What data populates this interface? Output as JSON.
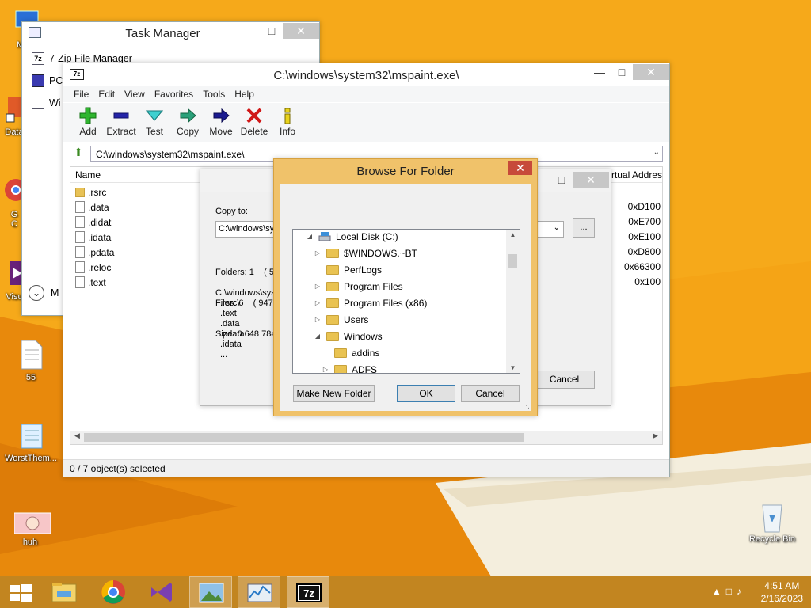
{
  "desktop": {
    "icons": [
      {
        "label": "My C",
        "icon": "computer-icon"
      },
      {
        "label": "Data",
        "icon": "shortcut-icon"
      },
      {
        "label": "G\nC",
        "icon": "chrome-icon"
      },
      {
        "label": "Visu",
        "icon": "visual-studio-icon"
      },
      {
        "label": "55",
        "icon": "text-file-icon"
      },
      {
        "label": "WorstThem...",
        "icon": "notepad-icon"
      },
      {
        "label": "huh",
        "icon": "image-icon"
      },
      {
        "label": "Recycle Bin",
        "icon": "recycle-bin-icon"
      }
    ]
  },
  "task_manager": {
    "title": "Task Manager",
    "items": [
      {
        "label": "7-Zip File Manager",
        "icon": "7z-icon"
      },
      {
        "label": "PC",
        "icon": "app-icon"
      },
      {
        "label": "Wi",
        "icon": "window-icon"
      }
    ],
    "footer": "M"
  },
  "zip": {
    "title": "C:\\windows\\system32\\mspaint.exe\\",
    "menu": [
      "File",
      "Edit",
      "View",
      "Favorites",
      "Tools",
      "Help"
    ],
    "toolbar": [
      {
        "label": "Add",
        "icon": "add-icon"
      },
      {
        "label": "Extract",
        "icon": "extract-icon"
      },
      {
        "label": "Test",
        "icon": "test-icon"
      },
      {
        "label": "Copy",
        "icon": "copy-icon"
      },
      {
        "label": "Move",
        "icon": "move-icon"
      },
      {
        "label": "Delete",
        "icon": "delete-icon"
      },
      {
        "label": "Info",
        "icon": "info-icon"
      }
    ],
    "address": "C:\\windows\\system32\\mspaint.exe\\",
    "columns": {
      "name": "Name",
      "vaddr": "rtual Addres"
    },
    "files": [
      {
        "name": ".rsrc",
        "folder": true,
        "vaddr": "0xD100"
      },
      {
        "name": ".data",
        "folder": false,
        "vaddr": "0xE700"
      },
      {
        "name": ".didat",
        "folder": false,
        "vaddr": "0xE100"
      },
      {
        "name": ".idata",
        "folder": false,
        "vaddr": "0xD800"
      },
      {
        "name": ".pdata",
        "folder": false,
        "vaddr": "0x66300"
      },
      {
        "name": ".reloc",
        "folder": false,
        "vaddr": "0x100"
      },
      {
        "name": ".text",
        "folder": false,
        "vaddr": ""
      }
    ],
    "status": "0 / 7 object(s) selected"
  },
  "copy_dialog": {
    "copy_to_label": "Copy to:",
    "path": "C:\\windows\\sy",
    "browse": "...",
    "info": [
      "Folders: 1    ( 5",
      "Files: 6    ( 947",
      "Size: 6 648 784"
    ],
    "list": [
      "C:\\windows\\sys",
      ".rsrc\\",
      ".text",
      ".data",
      ".pdata",
      ".idata",
      "..."
    ],
    "cancel": "Cancel"
  },
  "browse": {
    "title": "Browse For Folder",
    "tree": [
      {
        "label": "Local Disk (C:)",
        "level": 0,
        "expand": "open",
        "type": "disk"
      },
      {
        "label": "$WINDOWS.~BT",
        "level": 1,
        "expand": "closed",
        "type": "folder"
      },
      {
        "label": "PerfLogs",
        "level": 1,
        "expand": "none",
        "type": "folder"
      },
      {
        "label": "Program Files",
        "level": 1,
        "expand": "closed",
        "type": "folder"
      },
      {
        "label": "Program Files (x86)",
        "level": 1,
        "expand": "closed",
        "type": "folder"
      },
      {
        "label": "Users",
        "level": 1,
        "expand": "closed",
        "type": "folder"
      },
      {
        "label": "Windows",
        "level": 1,
        "expand": "open",
        "type": "folder"
      },
      {
        "label": "addins",
        "level": 2,
        "expand": "none",
        "type": "folder"
      },
      {
        "label": "ADFS",
        "level": 2,
        "expand": "closed",
        "type": "folder"
      }
    ],
    "make_new_folder": "Make New Folder",
    "ok": "OK",
    "cancel": "Cancel"
  },
  "taskbar": {
    "items": [
      "start-icon",
      "file-explorer-icon",
      "chrome-icon",
      "visual-studio-icon",
      "photos-icon",
      "task-manager-icon",
      "7z-icon"
    ],
    "time": "4:51 AM",
    "date": "2/16/2023"
  },
  "colors": {
    "accent": "#f0c26a",
    "desktop": "#f39a10",
    "close_active": "#c74a3a"
  }
}
